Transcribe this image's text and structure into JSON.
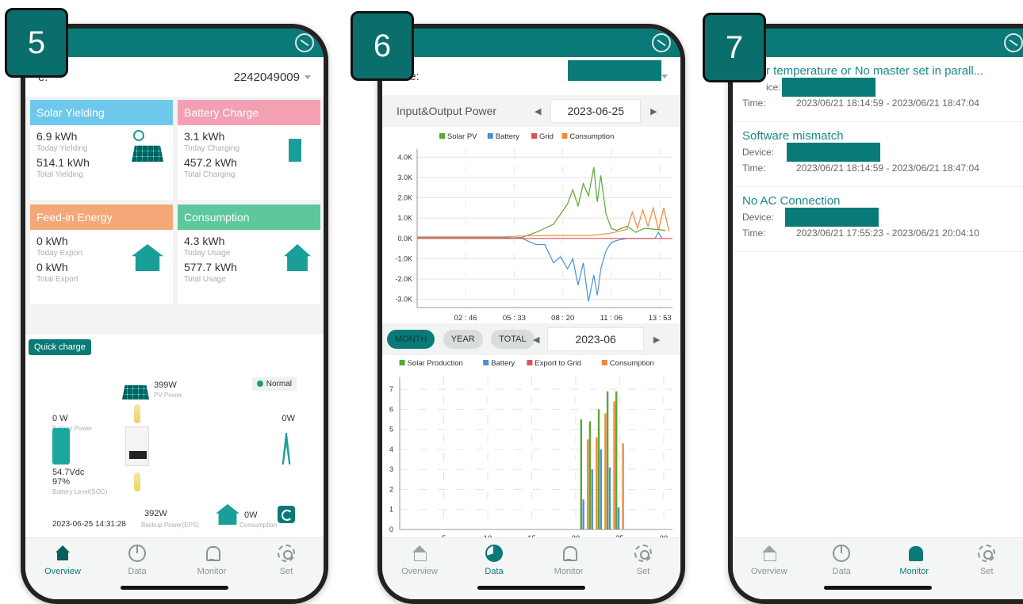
{
  "colors": {
    "accent": "#0a7a78",
    "solar": "#5aa832",
    "battery": "#4a90d9",
    "grid": "#e2505a",
    "consumption": "#f08a3a",
    "card_solar": "#6ec8ec",
    "card_battery": "#f2a0b2",
    "card_feed": "#f4a878",
    "card_consumption": "#5cc89c"
  },
  "badges": [
    "5",
    "6",
    "7"
  ],
  "phone5": {
    "device_label": "e:",
    "device_value": "2242049009",
    "cards": [
      {
        "title": "Solar Yielding",
        "v1": "6.9 kWh",
        "l1": "Today Yielding",
        "v2": "514.1 kWh",
        "l2": "Total Yielding",
        "icon": "solar-panel-icon"
      },
      {
        "title": "Battery Charge",
        "v1": "3.1 kWh",
        "l1": "Today Charging",
        "v2": "457.2 kWh",
        "l2": "Total Charging",
        "icon": "battery-charge-icon"
      },
      {
        "title": "Feed-in Energy",
        "v1": "0 kWh",
        "l1": "Today Export",
        "v2": "0 kWh",
        "l2": "Total Export",
        "icon": "house-grid-icon"
      },
      {
        "title": "Consumption",
        "v1": "4.3 kWh",
        "l1": "Today Usage",
        "v2": "577.7 kWh",
        "l2": "Total Usage",
        "icon": "house-bolt-icon"
      }
    ],
    "flow": {
      "quick_charge": "Quick charge",
      "pv_value": "399W",
      "pv_label": "PV Power",
      "status": "Normal",
      "battery_power": "0 W",
      "battery_power_label": "Battery Power",
      "grid_value": "0W",
      "battery_voltage": "54.7Vdc",
      "battery_soc": "97%",
      "battery_soc_label": "Battery Level(SOC)",
      "timestamp": "2023-06-25 14:31:28",
      "eps_value": "392W",
      "eps_label": "Backup Power(EPS)",
      "consumption_value": "0W",
      "consumption_label": "Consumption"
    }
  },
  "phone6": {
    "device_label": "vice:",
    "chart1": {
      "title": "Input&Output Power",
      "date": "2023-06-25"
    },
    "chart2": {
      "pills": [
        "MONTH",
        "YEAR",
        "TOTAL"
      ],
      "date": "2023-06"
    }
  },
  "phone7": {
    "alarms": [
      {
        "title": "r temperature or No master set in parall...",
        "device_label": "ice:",
        "time_label": "Time:",
        "time": "2023/06/21 18:14:59 - 2023/06/21 18:47:04"
      },
      {
        "title": "Software mismatch",
        "device_label": "Device:",
        "time_label": "Time:",
        "time": "2023/06/21 18:14:59 - 2023/06/21 18:47:04"
      },
      {
        "title": "No AC Connection",
        "device_label": "Device:",
        "time_label": "Time:",
        "time": "2023/06/21 17:55:23 - 2023/06/21 20:04:10"
      }
    ]
  },
  "tabs": [
    "Overview",
    "Data",
    "Monitor",
    "Set"
  ],
  "chart_data": [
    {
      "type": "line",
      "title": "Input&Output Power",
      "legend": [
        "Solar PV",
        "Battery",
        "Grid",
        "Consumption"
      ],
      "legend_position": "top-center",
      "x_ticks": [
        "02 : 46",
        "05 : 33",
        "08 : 20",
        "11 : 06",
        "13 : 53"
      ],
      "y_ticks": [
        "4.0K",
        "3.0K",
        "2.0K",
        "1.0K",
        "0.0K",
        "-1.0K",
        "-2.0K",
        "-3.0K"
      ],
      "ylim": [
        -3400,
        4400
      ],
      "xlim": [
        0,
        14.6
      ],
      "grid": true,
      "series": [
        {
          "name": "Solar PV",
          "x": [
            0,
            5.0,
            6.0,
            6.8,
            7.3,
            7.8,
            8.2,
            8.6,
            8.9,
            9.2,
            9.5,
            9.8,
            10.1,
            10.3,
            10.5,
            10.8,
            11.1,
            11.4,
            12.0,
            12.5,
            13.0,
            14.2
          ],
          "y": [
            0,
            0,
            50,
            300,
            500,
            700,
            1200,
            1700,
            2400,
            1600,
            2700,
            2100,
            3500,
            1800,
            3100,
            1200,
            500,
            400,
            600,
            300,
            500,
            400
          ]
        },
        {
          "name": "Battery",
          "x": [
            0,
            5.0,
            6.0,
            6.8,
            7.3,
            7.8,
            8.2,
            8.6,
            8.9,
            9.2,
            9.5,
            9.8,
            10.1,
            10.3,
            10.5,
            10.8,
            11.1,
            11.4,
            12.0,
            12.5,
            13.6,
            13.8,
            14.0
          ],
          "y": [
            50,
            50,
            0,
            -300,
            -300,
            -1200,
            -900,
            -1500,
            -1000,
            -2300,
            -1200,
            -3100,
            -1800,
            -2800,
            -1500,
            -600,
            -200,
            -100,
            0,
            0,
            0,
            300,
            0
          ]
        },
        {
          "name": "Grid",
          "x": [
            0,
            14.6
          ],
          "y": [
            0,
            0
          ]
        },
        {
          "name": "Consumption",
          "x": [
            0,
            5.0,
            6.0,
            8.0,
            10.0,
            11.0,
            12.0,
            12.3,
            12.6,
            12.9,
            13.2,
            13.5,
            13.8,
            14.1,
            14.4
          ],
          "y": [
            80,
            80,
            120,
            150,
            150,
            250,
            450,
            1300,
            500,
            1400,
            600,
            1500,
            400,
            1500,
            350
          ]
        }
      ]
    },
    {
      "type": "bar",
      "legend": [
        "Solar Production",
        "Battery",
        "Export to Grid",
        "Consumption"
      ],
      "legend_position": "top-center",
      "x_ticks": [
        "5",
        "10",
        "15",
        "20",
        "25",
        "30"
      ],
      "y_ticks": [
        "0",
        "1",
        "2",
        "3",
        "4",
        "5",
        "6",
        "7"
      ],
      "ylim": [
        0,
        7.6
      ],
      "xlim": [
        0,
        31
      ],
      "grid": true,
      "categories": [
        21,
        22,
        23,
        24,
        25
      ],
      "series": [
        {
          "name": "Solar Production",
          "values": [
            5.5,
            5.4,
            6.0,
            6.9,
            6.9
          ]
        },
        {
          "name": "Battery",
          "values": [
            1.5,
            3.0,
            4.0,
            3.1,
            1.1
          ]
        },
        {
          "name": "Export to Grid",
          "values": [
            0,
            0,
            0,
            0,
            0
          ]
        },
        {
          "name": "Consumption",
          "values": [
            4.5,
            4.6,
            5.8,
            6.4,
            4.3
          ]
        }
      ]
    }
  ]
}
